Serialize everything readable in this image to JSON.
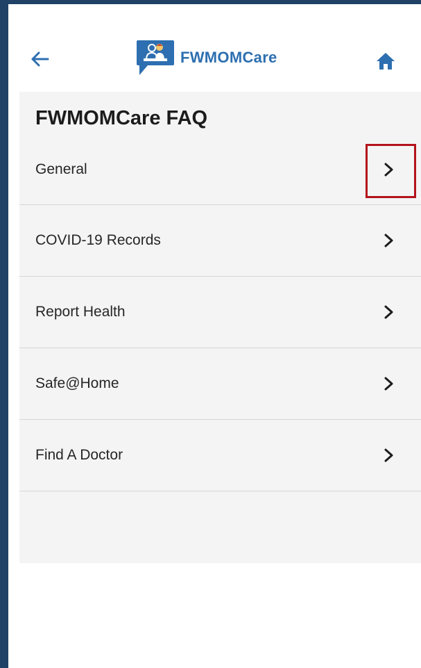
{
  "header": {
    "back_icon": "arrow-left-icon",
    "logo_icon": "fwmomcare-logo-icon",
    "app_title": "FWMOMCare",
    "home_icon": "home-icon",
    "accent_color": "#2d6fb0"
  },
  "main": {
    "page_title": "FWMOMCare FAQ",
    "items": [
      {
        "label": "General",
        "icon": "chevron-right-icon"
      },
      {
        "label": "COVID-19 Records",
        "icon": "chevron-right-icon"
      },
      {
        "label": "Report Health",
        "icon": "chevron-right-icon"
      },
      {
        "label": "Safe@Home",
        "icon": "chevron-right-icon"
      },
      {
        "label": "Find A Doctor",
        "icon": "chevron-right-icon"
      }
    ]
  },
  "annotation": {
    "highlight_color": "#b3131b"
  }
}
